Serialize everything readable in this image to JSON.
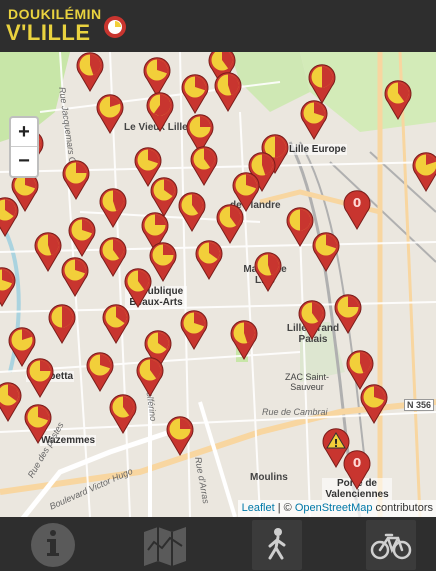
{
  "header": {
    "logo_line1": "DOUKILÉMIN",
    "logo_line2": "V'LILLE"
  },
  "map": {
    "zoom_in_label": "+",
    "zoom_out_label": "−",
    "attribution": {
      "leaflet": "Leaflet",
      "separator": " | © ",
      "osm": "OpenStreetMap",
      "suffix": " contributors"
    },
    "labels": [
      {
        "text": "Le Vieux Lille",
        "kind": "area"
      },
      {
        "text": "Lille Europe",
        "kind": "metro"
      },
      {
        "text": "de Flandre",
        "kind": "area"
      },
      {
        "text": "Mairie de Lille",
        "kind": "area"
      },
      {
        "text": "Lille Grand Palais",
        "kind": "area"
      },
      {
        "text": "République Beaux-Arts",
        "kind": "metro"
      },
      {
        "text": "Gambetta",
        "kind": "metro"
      },
      {
        "text": "Wazemmes",
        "kind": "metro"
      },
      {
        "text": "ZAC Saint-Sauveur",
        "kind": "area"
      },
      {
        "text": "Rue de Cambrai",
        "kind": "road"
      },
      {
        "text": "Moulins",
        "kind": "area"
      },
      {
        "text": "Porte de Valenciennes",
        "kind": "metro"
      },
      {
        "text": "Boulevard Victor Hugo",
        "kind": "road"
      },
      {
        "text": "N 356",
        "kind": "shield"
      },
      {
        "text": "Rue des postes",
        "kind": "road"
      },
      {
        "text": "Rue d'Arras",
        "kind": "road"
      },
      {
        "text": "Rue Jacquemars Giélée",
        "kind": "road"
      },
      {
        "text": "Rue Solférino",
        "kind": "road"
      }
    ],
    "markers": [
      {
        "fill": 0.55,
        "label": ""
      },
      {
        "fill": 0.7,
        "label": ""
      },
      {
        "fill": 0.6,
        "label": ""
      },
      {
        "fill": 0.7,
        "label": ""
      },
      {
        "fill": 0.55,
        "label": ""
      },
      {
        "fill": 0.5,
        "label": ""
      },
      {
        "fill": 0.6,
        "label": ""
      },
      {
        "fill": 0.8,
        "label": ""
      },
      {
        "fill": 0.4,
        "label": ""
      },
      {
        "fill": 0.7,
        "label": ""
      },
      {
        "fill": 0.65,
        "label": ""
      },
      {
        "fill": 0.75,
        "label": ""
      },
      {
        "fill": 0.5,
        "label": ""
      },
      {
        "fill": 0.6,
        "label": ""
      },
      {
        "fill": 0.7,
        "label": ""
      },
      {
        "fill": 0.55,
        "label": ""
      },
      {
        "fill": 0.75,
        "label": ""
      },
      {
        "fill": 0.65,
        "label": ""
      },
      {
        "fill": 0.55,
        "label": ""
      },
      {
        "fill": 0.7,
        "label": ""
      },
      {
        "fill": 0.6,
        "label": ""
      },
      {
        "fill": 0.8,
        "label": ""
      },
      {
        "fill": 0.7,
        "label": ""
      },
      {
        "fill": 0.65,
        "label": ""
      },
      {
        "fill": 0.5,
        "label": ""
      },
      {
        "fill": 0.75,
        "label": ""
      },
      {
        "fill": 0.6,
        "label": ""
      },
      {
        "fill": 0.7,
        "label": ""
      },
      {
        "fill": 0.55,
        "label": ""
      },
      {
        "fill": 0.7,
        "label": ""
      },
      {
        "fill": 0.6,
        "label": ""
      },
      {
        "fill": 0.75,
        "label": ""
      },
      {
        "fill": 0.65,
        "label": ""
      },
      {
        "fill": 0.7,
        "label": ""
      },
      {
        "fill": 0.55,
        "label": ""
      },
      {
        "fill": 0.6,
        "label": ""
      },
      {
        "fill": 0.7,
        "label": ""
      },
      {
        "fill": 0.5,
        "label": ""
      },
      {
        "fill": 0.65,
        "label": ""
      },
      {
        "fill": 0.75,
        "label": ""
      },
      {
        "fill": 0.6,
        "label": ""
      },
      {
        "fill": 0.7,
        "label": ""
      },
      {
        "fill": 0.55,
        "label": ""
      },
      {
        "fill": 0.8,
        "label": ""
      },
      {
        "fill": 0.65,
        "label": ""
      },
      {
        "fill": 0.7,
        "label": ""
      },
      {
        "fill": 0.6,
        "label": ""
      },
      {
        "fill": 0.75,
        "label": ""
      },
      {
        "fill": 0.55,
        "label": ""
      },
      {
        "fill": 0.7,
        "label": ""
      },
      {
        "fill": 0.65,
        "label": ""
      },
      {
        "fill": 0.6,
        "label": ""
      },
      {
        "fill": 0.7,
        "label": ""
      },
      {
        "fill": 0.75,
        "label": ""
      },
      {
        "fill": 0.0,
        "label": "0"
      },
      {
        "fill": 0.0,
        "label": "0"
      },
      {
        "fill": 0.0,
        "label": "!"
      }
    ],
    "colors": {
      "pin_red": "#c8352f",
      "pin_yellow": "#f2cf3a",
      "pin_dark": "#7a1d1a",
      "water": "#aad3df",
      "park": "#c8e6a8",
      "rail": "#aaaaaa",
      "road_major": "#f8d6a0",
      "accent_yellow": "#e9d23f"
    }
  },
  "footer": {
    "buttons": [
      {
        "name": "info",
        "icon": "info-icon",
        "active": false
      },
      {
        "name": "map",
        "icon": "map-icon",
        "active": false
      },
      {
        "name": "walk",
        "icon": "walking-person-icon",
        "active": true
      },
      {
        "name": "bike",
        "icon": "bicycle-icon",
        "active": true
      }
    ]
  }
}
